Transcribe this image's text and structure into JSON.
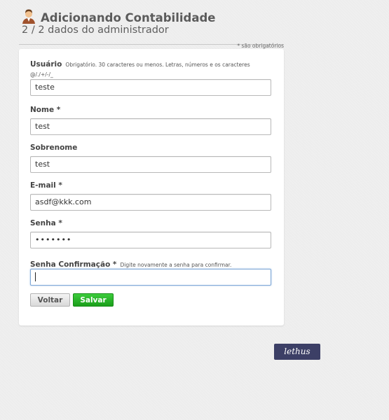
{
  "header": {
    "title": "Adicionando Contabilidade",
    "subtitle": "2 / 2 dados do administrador",
    "avatar_icon": "user-avatar-icon"
  },
  "required_note": "* são obrigatórios",
  "form": {
    "username": {
      "label": "Usuário",
      "hint": "Obrigatório. 30 caracteres ou menos. Letras, números e os caracteres",
      "hint2": "@/./+/-/_",
      "value": "teste"
    },
    "first_name": {
      "label": "Nome *",
      "value": "test"
    },
    "last_name": {
      "label": "Sobrenome",
      "value": "test"
    },
    "email": {
      "label": "E-mail *",
      "value": "asdf@kkk.com"
    },
    "password": {
      "label": "Senha *",
      "value": "•••••••"
    },
    "password_confirm": {
      "label": "Senha Confirmação *",
      "hint": "Digite novamente a senha para confirmar.",
      "value": ""
    }
  },
  "buttons": {
    "back": "Voltar",
    "save": "Salvar"
  },
  "logo": {
    "text": "lethus"
  },
  "colors": {
    "save_button": "#22aa22",
    "logo_bg": "#3c3f66",
    "focus_border": "#7fa8d6"
  }
}
